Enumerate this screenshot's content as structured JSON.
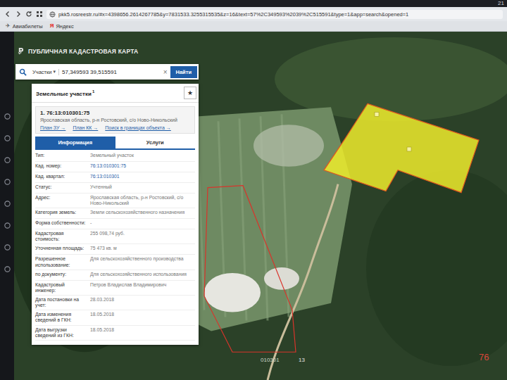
{
  "browser": {
    "tab_badge": "21",
    "url": "pkk5.rosreestr.ru/#x=4398656.2614267785&y=7831533.3255315535&z=16&text=57%2C349593%2039%2C515591&type=1&app=search&opened=1",
    "bookmarks": [
      {
        "icon": "✈",
        "label": "Авиабилеты"
      },
      {
        "icon": "Я",
        "label": "Яндекс"
      }
    ]
  },
  "app": {
    "title": "ПУБЛИЧНАЯ КАДАСТРОВАЯ КАРТА"
  },
  "search": {
    "type": "Участки",
    "dropdown_arrow": "▾",
    "value": "57,349593 39,515591",
    "clear": "×",
    "button": "Найти"
  },
  "results": {
    "title": "Земельные участки",
    "count": "1",
    "star": "★",
    "items": [
      {
        "index": "1.",
        "number": "76:13:010301:75",
        "address": "Ярославская область, р-н Ростовский, с/о Ново-Никольский",
        "links": [
          "План ЗУ →",
          "План КК →",
          "Поиск в границах объекта →"
        ]
      }
    ]
  },
  "tabs": [
    {
      "label": "Информация",
      "selected": true
    },
    {
      "label": "Услуги",
      "selected": false
    }
  ],
  "details": [
    {
      "label": "Тип:",
      "value": "Земельный участок",
      "link": false
    },
    {
      "label": "Кад. номер:",
      "value": "76:13:010301:75",
      "link": true
    },
    {
      "label": "Кад. квартал:",
      "value": "76:13:010301",
      "link": true
    },
    {
      "label": "Статус:",
      "value": "Учтенный",
      "link": false
    },
    {
      "label": "Адрес:",
      "value": "Ярославская область, р-н Ростовский, с/о Ново-Никольский",
      "link": false
    },
    {
      "label": "Категория земель:",
      "value": "Земли сельскохозяйственного назначения",
      "link": false
    },
    {
      "label": "Форма собственности:",
      "value": "-",
      "link": false
    },
    {
      "label": "Кадастровая стоимость:",
      "value": "255 098,74 руб.",
      "link": false
    },
    {
      "label": "Уточненная площадь:",
      "value": "75 473 кв. м",
      "link": false
    },
    {
      "label": "Разрешенное использование:",
      "value": "Для сельскохозяйственного производства",
      "link": false
    },
    {
      "label": "по документу:",
      "value": "Для сельскохозяйственного использования",
      "link": false
    },
    {
      "label": "Кадастровый инженер:",
      "value": "Петров Владислав Владимирович",
      "link": false
    },
    {
      "label": "Дата постановки на учет:",
      "value": "28.03.2018",
      "link": false
    },
    {
      "label": "Дата изменения сведений в ГКН:",
      "value": "18.05.2018",
      "link": false
    },
    {
      "label": "Дата выгрузки сведений из ГКН:",
      "value": "18.05.2018",
      "link": false
    }
  ],
  "map": {
    "labels": [
      "010301",
      "13",
      "76"
    ]
  }
}
